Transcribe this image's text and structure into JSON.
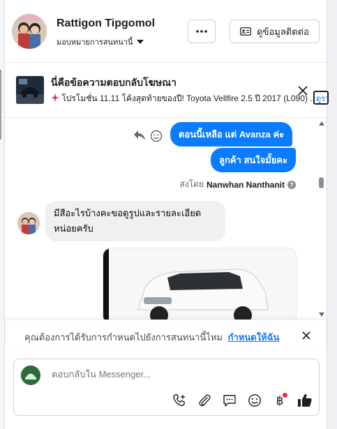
{
  "header": {
    "contact_name": "Rattigon Tipgomol",
    "assign_label": "มอบหมายการสนทนานี้",
    "contact_info_label": "ดูข้อมูลติดต่อ"
  },
  "ad_banner": {
    "title": "นี่คือข้อความตอบกลับโฆษณา",
    "subtitle": "โปรโมชั่น 11.11 โค้งสุดท้ายของปี! Toyota Vellfire 2.5 ปี 2017 (L090) ...",
    "peek_label": "ดูรา"
  },
  "messages": {
    "outgoing_1": "ตอนนี้เหลือ แต่  Avanza ค่ะ",
    "outgoing_2": "ลูกค้า สนใจมั้ยคะ",
    "sent_by_prefix": "ส่งโดย",
    "sent_by_name": "Nanwhan Nanthanit",
    "incoming_1_line1": "มีสีอะไรบ้างคะขอดูรูปและรายละเอียด",
    "incoming_1_line2": "หน่อยครับ"
  },
  "notice": {
    "text": "คุณต้องการได้รับการกำหนดไปยังการสนทนานี้ไหม",
    "link": "กำหนดให้ฉัน"
  },
  "composer": {
    "placeholder": "ตอบกลับใน Messenger..."
  },
  "colors": {
    "brand_blue": "#0a7cff",
    "link_blue": "#1877f2",
    "notification_dot": "#f02849"
  }
}
